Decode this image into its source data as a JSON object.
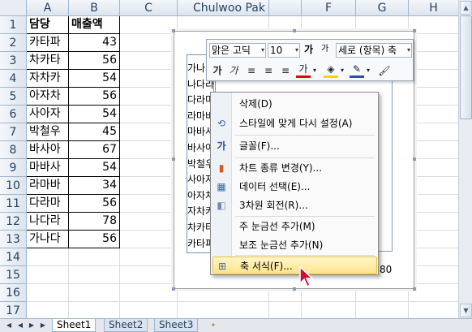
{
  "title": "Chulwoo Pak",
  "columns": [
    "A",
    "B",
    "C",
    "D",
    "E",
    "F",
    "G",
    "H"
  ],
  "rows": [
    "1",
    "2",
    "3",
    "4",
    "5",
    "6",
    "7",
    "8",
    "9",
    "10",
    "11",
    "12",
    "13",
    "14",
    "15",
    "16",
    "17"
  ],
  "table": {
    "header": [
      "담당",
      "매출액"
    ],
    "data": [
      [
        "카타파",
        "43"
      ],
      [
        "차카타",
        "56"
      ],
      [
        "자차카",
        "54"
      ],
      [
        "아자차",
        "56"
      ],
      [
        "사아자",
        "54"
      ],
      [
        "박철우",
        "45"
      ],
      [
        "바사아",
        "67"
      ],
      [
        "마바사",
        "54"
      ],
      [
        "라마바",
        "34"
      ],
      [
        "다라마",
        "56"
      ],
      [
        "나다라",
        "78"
      ],
      [
        "가나다",
        "56"
      ]
    ]
  },
  "chart": {
    "axis_labels": [
      "가나다",
      "나다라",
      "다라마",
      "라마바",
      "마바사",
      "바사아",
      "박철우",
      "사아자",
      "아자차",
      "자차카",
      "차카타",
      "카타파"
    ],
    "axis_value_tail": "80"
  },
  "mini_toolbar": {
    "font": "맑은 고딕",
    "size": "10",
    "grow": "가",
    "shrink": "가",
    "direction": "세로 (항목) 축",
    "bold": "가",
    "italic": "가",
    "font_color_label": "가"
  },
  "context_menu": {
    "items": [
      "삭제(D)",
      "스타일에 맞게 다시 설정(A)",
      "글꼴(F)...",
      "차트 종류 변경(Y)...",
      "데이터 선택(E)...",
      "3차원 회전(R)...",
      "주 눈금선 추가(M)",
      "보조 눈금선 추가(N)",
      "축 서식(F)..."
    ],
    "highlighted": "축 서식(F)..."
  },
  "sheet_tabs": [
    "Sheet1",
    "Sheet2",
    "Sheet3"
  ],
  "active_tab": "Sheet1"
}
